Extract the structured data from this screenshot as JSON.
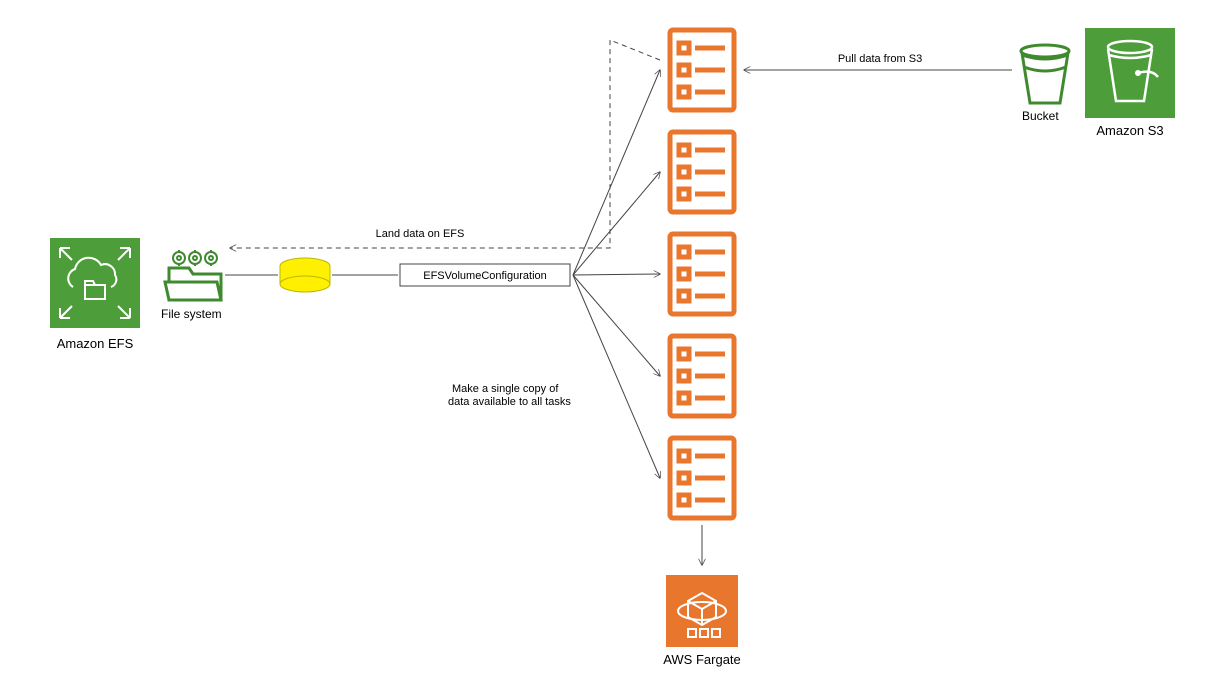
{
  "services": {
    "efs": {
      "label": "Amazon EFS",
      "icon_label": "File system"
    },
    "s3": {
      "label": "Amazon S3",
      "icon_label": "Bucket"
    },
    "fargate": {
      "label": "AWS Fargate"
    }
  },
  "config_box": {
    "label": "EFSVolumeConfiguration"
  },
  "annotations": {
    "pull": "Pull data from S3",
    "land": "Land data on EFS",
    "single_copy_l1": "Make a single copy of",
    "single_copy_l2": "data available to all tasks"
  },
  "colors": {
    "efs_green": "#4D9E3A",
    "efs_line": "#3F8A2F",
    "s3_green": "#4D9E3A",
    "s3_line": "#3F8A2F",
    "fargate_orange": "#E8762C",
    "task_orange": "#E8762C",
    "bucket_stroke": "#3F8A2F",
    "disk_yellow": "#FFEF00",
    "disk_stroke": "#B8B800"
  },
  "layout": {
    "tasks_count": 5
  }
}
